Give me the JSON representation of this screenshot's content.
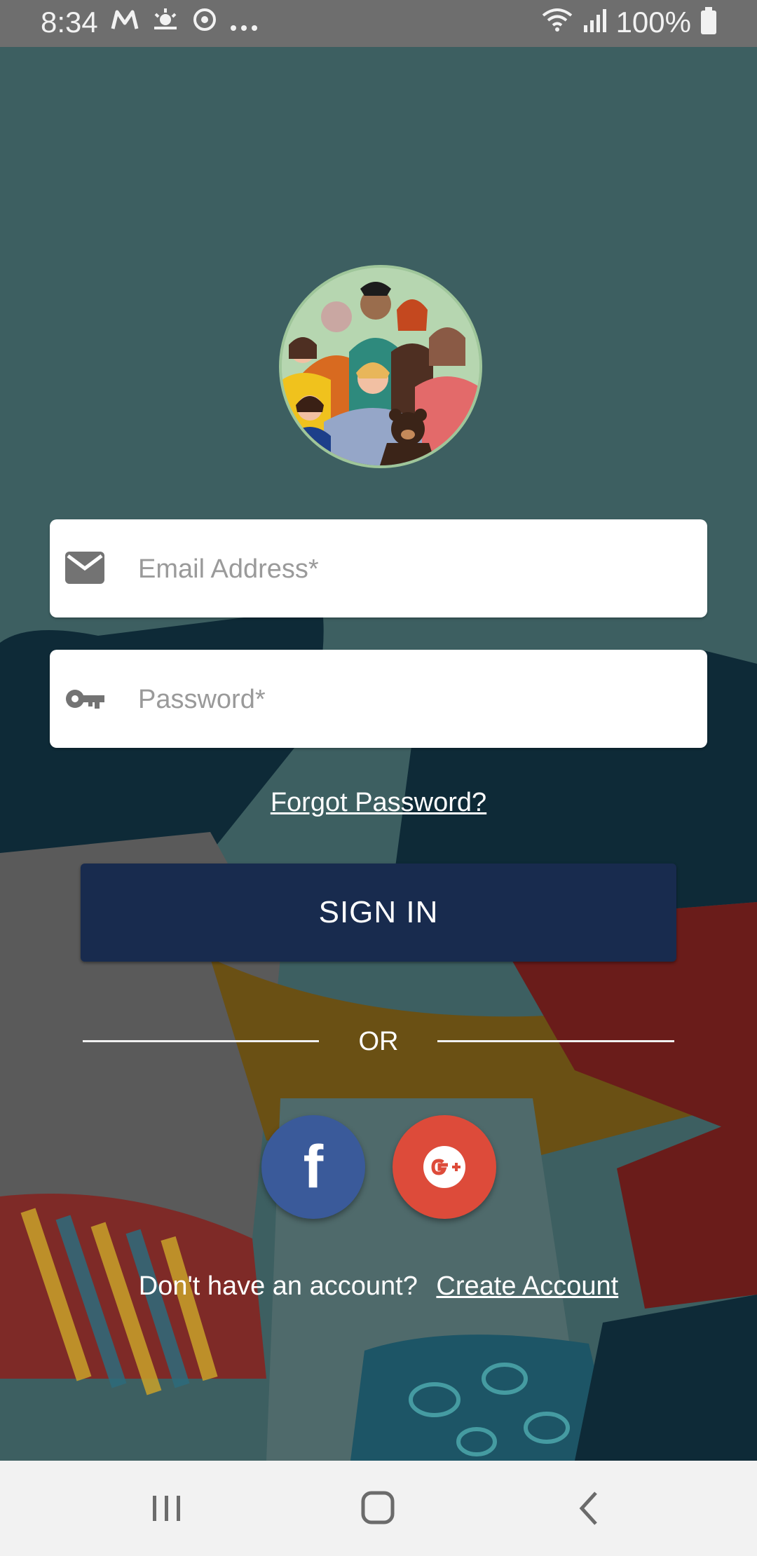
{
  "status_bar": {
    "time": "8:34",
    "left_icons": [
      "gmail-m-icon",
      "weather-icon",
      "sync-icon",
      "more-dots-icon"
    ],
    "battery": "100%"
  },
  "login": {
    "email_placeholder": "Email Address*",
    "password_placeholder": "Password*",
    "forgot_password": "Forgot Password?",
    "sign_in": "SIGN IN",
    "or": "OR",
    "signup_prompt": "Don't have an account?",
    "create_account": "Create Account"
  },
  "social": {
    "facebook_glyph": "f",
    "google_label": "G+"
  },
  "colors": {
    "status_bar": "#6e6e6e",
    "background": "#3d5f61",
    "sign_in_button": "#182b4e",
    "facebook": "#3a5a9a",
    "google": "#dd4b3a",
    "nav_bar": "#f2f2f2"
  }
}
